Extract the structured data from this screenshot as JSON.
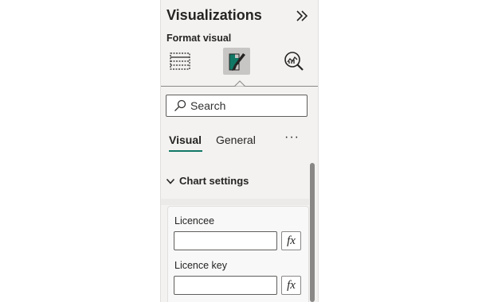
{
  "pane": {
    "title": "Visualizations",
    "subtitle": "Format visual",
    "collapse_icon": "double-chevron-right-icon"
  },
  "view_buttons": [
    {
      "name": "fields-icon",
      "active": false
    },
    {
      "name": "format-paintbrush-icon",
      "active": true
    },
    {
      "name": "analytics-icon",
      "active": false
    }
  ],
  "search": {
    "placeholder": "Search",
    "value": ""
  },
  "tabs": [
    {
      "label": "Visual",
      "active": true
    },
    {
      "label": "General",
      "active": false
    }
  ],
  "more_label": "···",
  "section": {
    "label": "Chart settings",
    "expanded": true,
    "fields": [
      {
        "label": "Licencee",
        "value": "",
        "fx": "fx"
      },
      {
        "label": "Licence key",
        "value": "",
        "fx": "fx"
      }
    ]
  },
  "colors": {
    "accent": "#117865",
    "active_icon_bg": "#c8c6c4"
  }
}
